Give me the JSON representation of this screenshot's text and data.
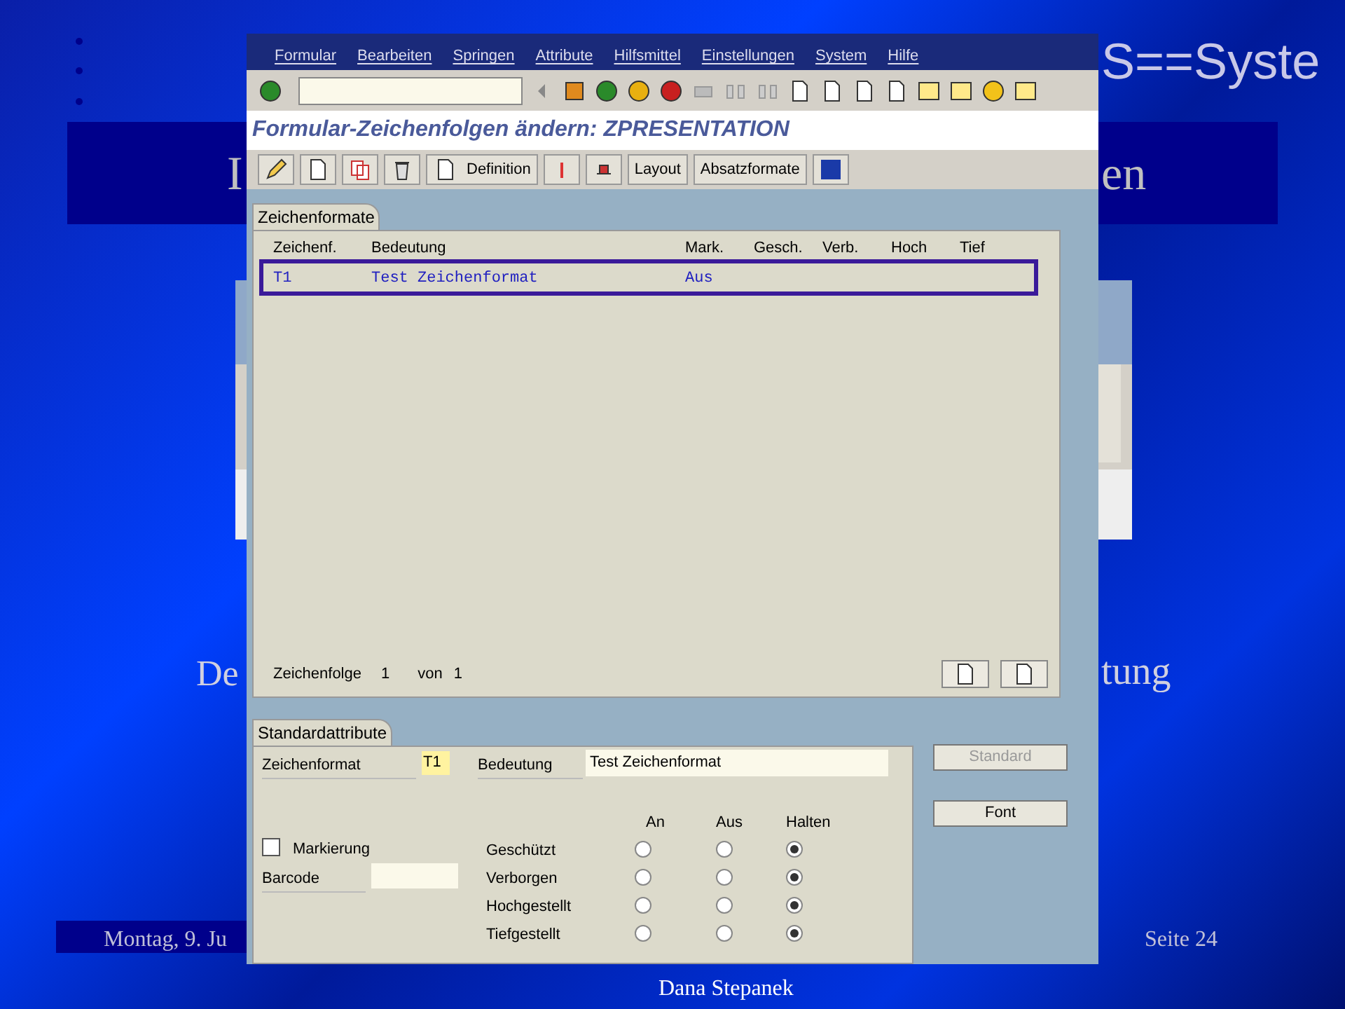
{
  "slide": {
    "header_fragment": "S==Syste",
    "title_left_fragment": "I",
    "title_right_fragment": "en",
    "body_left_fragment": "De",
    "body_right_fragment": "tung",
    "footer_date": "Montag, 9. Ju",
    "footer_page": "Seite 24",
    "footer_author": "Dana Stepanek"
  },
  "window": {
    "menu": [
      "Formular",
      "Bearbeiten",
      "Springen",
      "Attribute",
      "Hilfsmittel",
      "Einstellungen",
      "System",
      "Hilfe"
    ],
    "title": "Formular-Zeichenfolgen ändern: ZPRESENTATION",
    "app_buttons": [
      "Definition",
      "Layout",
      "Absatzformate"
    ]
  },
  "table_panel": {
    "tab": "Zeichenformate",
    "columns": [
      "Zeichenf.",
      "Bedeutung",
      "Mark.",
      "Gesch.",
      "Verb.",
      "Hoch",
      "Tief"
    ],
    "rows": [
      {
        "cells": [
          "T1",
          "Test Zeichenformat",
          "Aus",
          "",
          "",
          "",
          ""
        ],
        "selected": true
      }
    ],
    "footer": {
      "label": "Zeichenfolge",
      "current": "1",
      "of": "von",
      "total": "1"
    }
  },
  "attributes_panel": {
    "tab": "Standardattribute",
    "format_label": "Zeichenformat",
    "format_value": "T1",
    "meaning_label": "Bedeutung",
    "meaning_value": "Test Zeichenformat",
    "mark": {
      "label": "Markierung",
      "checked": false
    },
    "barcode_label": "Barcode",
    "option_headers": [
      "An",
      "Aus",
      "Halten"
    ],
    "options": [
      {
        "label": "Geschützt",
        "choices": [
          {
            "selected": false
          },
          {
            "selected": false
          },
          {
            "selected": true
          }
        ]
      },
      {
        "label": "Verborgen",
        "choices": [
          {
            "selected": false
          },
          {
            "selected": false
          },
          {
            "selected": true
          }
        ]
      },
      {
        "label": "Hochgestellt",
        "choices": [
          {
            "selected": false
          },
          {
            "selected": false
          },
          {
            "selected": true
          }
        ]
      },
      {
        "label": "Tiefgestellt",
        "choices": [
          {
            "selected": false
          },
          {
            "selected": false
          },
          {
            "selected": true
          }
        ]
      }
    ]
  },
  "side_buttons": [
    {
      "label": "Standard",
      "disabled": true
    },
    {
      "label": "Font",
      "disabled": false
    }
  ]
}
